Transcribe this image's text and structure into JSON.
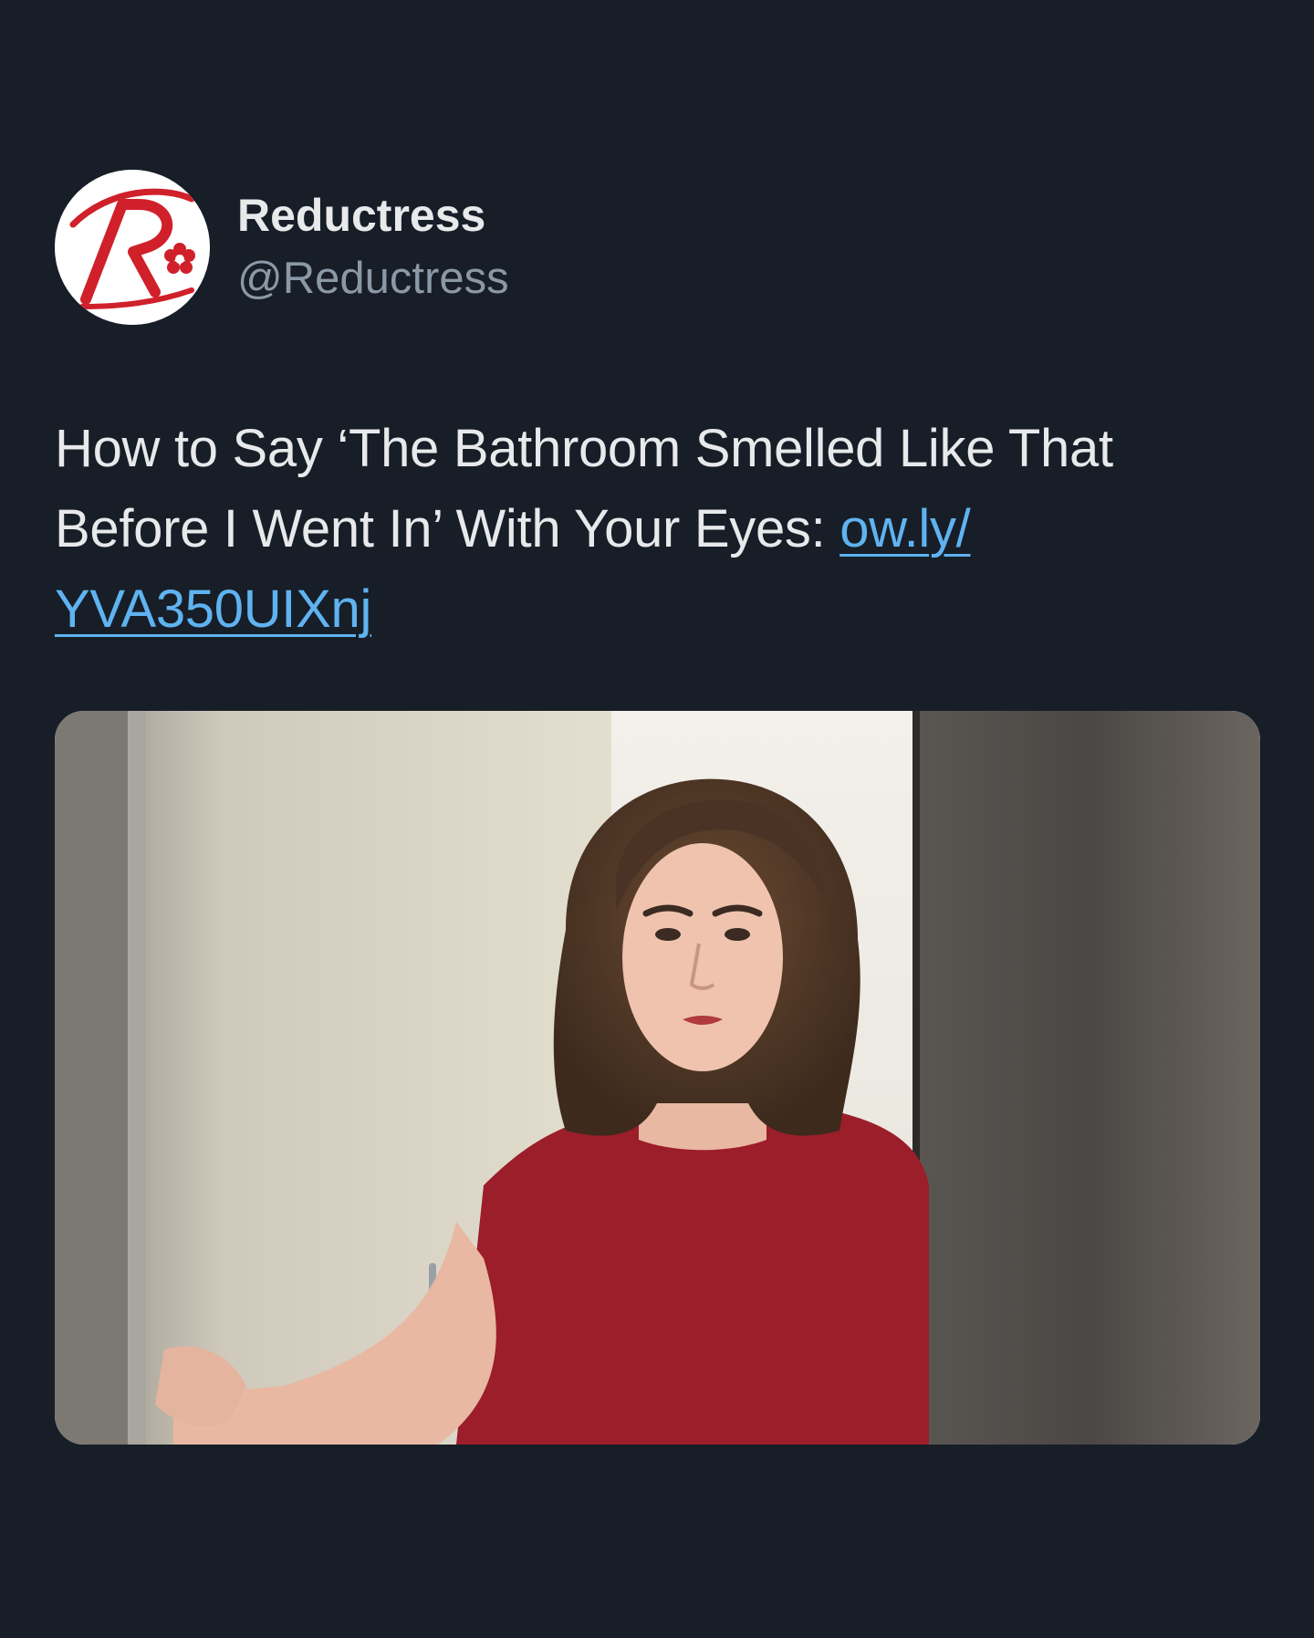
{
  "tweet": {
    "author": {
      "display_name": "Reductress",
      "handle": "@Reductress",
      "avatar_icon": "reductress-logo-icon",
      "avatar_letter": "R"
    },
    "text_prefix": "How to Say ‘The Bathroom Smelled Like That Before I Went In’ With Your Eyes: ",
    "link_line1": "ow.ly/",
    "link_line2": "YVA350UIXnj",
    "link_color": "#5fb3f0",
    "media": {
      "icon": "photo-bathroom-stall-woman",
      "description_visible": false
    }
  },
  "colors": {
    "background": "#171e28",
    "text": "#e7e9ea",
    "secondary_text": "#8b98a5",
    "brand_red": "#d0202a"
  }
}
